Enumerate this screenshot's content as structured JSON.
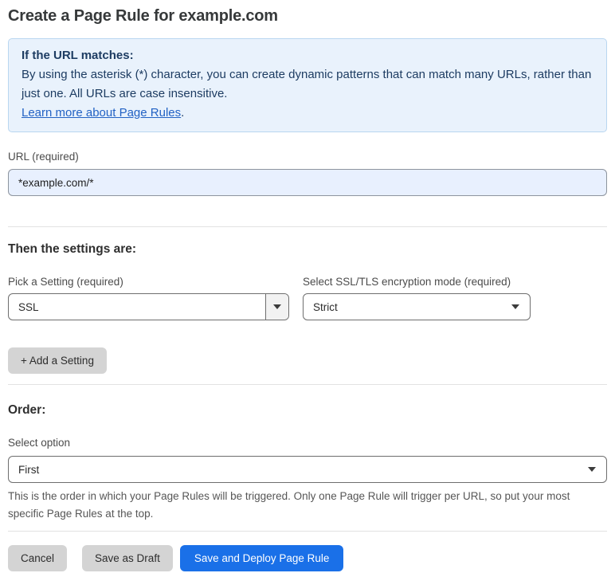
{
  "page": {
    "title": "Create a Page Rule for example.com"
  },
  "info_box": {
    "heading": "If the URL matches:",
    "body": "By using the asterisk (*) character, you can create dynamic patterns that can match many URLs, rather than just one. All URLs are case insensitive.",
    "link_label": "Learn more about Page Rules",
    "link_suffix": "."
  },
  "url_field": {
    "label": "URL (required)",
    "value": "*example.com/*"
  },
  "settings_section": {
    "heading": "Then the settings are:",
    "setting_select": {
      "label": "Pick a Setting (required)",
      "value": "SSL"
    },
    "mode_select": {
      "label": "Select SSL/TLS encryption mode (required)",
      "value": "Strict"
    },
    "add_setting_label": "+ Add a Setting"
  },
  "order_section": {
    "heading": "Order:",
    "select_label": "Select option",
    "select_value": "First",
    "help_text": "This is the order in which your Page Rules will be triggered. Only one Page Rule will trigger per URL, so put your most specific Page Rules at the top."
  },
  "footer": {
    "cancel_label": "Cancel",
    "save_draft_label": "Save as Draft",
    "save_deploy_label": "Save and Deploy Page Rule"
  },
  "colors": {
    "info_bg": "#e9f2fc",
    "info_border": "#b9d6f0",
    "info_text": "#1d3c62",
    "link": "#2262c4",
    "input_bg": "#e8f0fe",
    "primary_button": "#1a70e8",
    "gray_button": "#d4d4d4"
  }
}
